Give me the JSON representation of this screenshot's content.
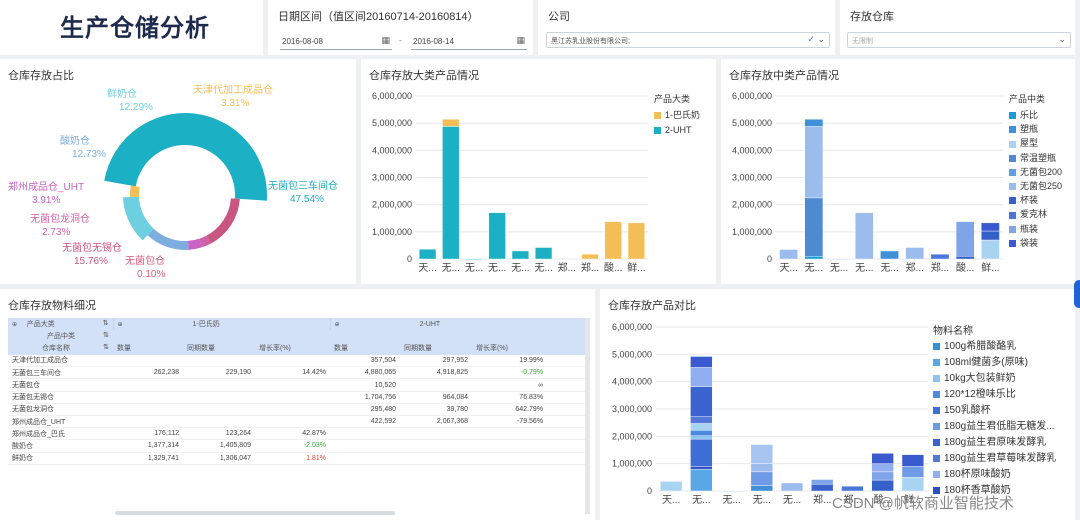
{
  "header": {
    "title": "生产仓储分析"
  },
  "filters": {
    "date_label": "日期区间（值区间20160714-20160814）",
    "date_start": "2016-08-08",
    "date_end": "2016-08-14",
    "date_sep": "-",
    "company_label": "公司",
    "company_value": "黑江苏乳业股份有限公司;",
    "warehouse_label": "存放仓库",
    "warehouse_placeholder": "无限制"
  },
  "donut": {
    "title": "仓库存放占比",
    "slices": [
      {
        "name": "无菌包三车间仓",
        "pct": "47.54%",
        "value": 47.54,
        "color": "#1bb0c4"
      },
      {
        "name": "无菌包仓",
        "pct": "0.10%",
        "value": 0.1,
        "color": "#e05b7d"
      },
      {
        "name": "无菌包无锡仓",
        "pct": "15.76%",
        "value": 15.76,
        "color": "#c9567f"
      },
      {
        "name": "无菌包龙洞仓",
        "pct": "2.73%",
        "value": 2.73,
        "color": "#d061a6"
      },
      {
        "name": "郑州成品仓_UHT",
        "pct": "3.91%",
        "value": 3.91,
        "color": "#c963c6"
      },
      {
        "name": "酸奶仓",
        "pct": "12.73%",
        "value": 12.73,
        "color": "#7eaee0"
      },
      {
        "name": "鲜奶仓",
        "pct": "12.29%",
        "value": 12.29,
        "color": "#6dcfe0"
      },
      {
        "name": "天津代加工成品仓",
        "pct": "3.31%",
        "value": 3.31,
        "color": "#f4be56"
      }
    ]
  },
  "big_chart": {
    "title": "仓库存放大类产品情况",
    "legend_title": "产品大类",
    "series": [
      {
        "name": "1-巴氏奶",
        "color": "#f4be56"
      },
      {
        "name": "2-UHT",
        "color": "#1bb0c4"
      }
    ]
  },
  "mid_chart": {
    "title": "仓库存放中类产品情况",
    "legend_title": "产品中类",
    "legend": [
      {
        "name": "乐比",
        "color": "#1a9bd7"
      },
      {
        "name": "塑瓶",
        "color": "#3f8fd9"
      },
      {
        "name": "屋型",
        "color": "#a8d4f2"
      },
      {
        "name": "常温塑瓶",
        "color": "#4e89d2"
      },
      {
        "name": "无菌包200",
        "color": "#5f9fe4"
      },
      {
        "name": "无菌包250",
        "color": "#9dbcee"
      },
      {
        "name": "杯装",
        "color": "#3460c9"
      },
      {
        "name": "爱克林",
        "color": "#4a76d8"
      },
      {
        "name": "瓶装",
        "color": "#7fa4e8"
      },
      {
        "name": "袋装",
        "color": "#3b5ad0"
      }
    ]
  },
  "cmp_chart": {
    "title": "仓库存放产品对比",
    "legend_title": "物料名称",
    "legend": [
      {
        "name": "100g希腊酸酪乳",
        "color": "#2f93d6"
      },
      {
        "name": "108ml健菌多(原味)",
        "color": "#5aa7e6"
      },
      {
        "name": "10kg大包装鲜奶",
        "color": "#8dc3f0"
      },
      {
        "name": "120*12橙味乐比",
        "color": "#4c8ae0"
      },
      {
        "name": "150乳酸杯",
        "color": "#3d6fd4"
      },
      {
        "name": "180g益生君低脂无糖发...",
        "color": "#6e9ae6"
      },
      {
        "name": "180g益生君原味发酵乳",
        "color": "#3b63cf"
      },
      {
        "name": "180g益生君草莓味发酵乳",
        "color": "#5378d9"
      },
      {
        "name": "180杯原味酸奶",
        "color": "#91aef0"
      },
      {
        "name": "180杯香草酸奶",
        "color": "#2a4fc4"
      }
    ]
  },
  "chart_data": [
    {
      "type": "pie",
      "title": "仓库存放占比",
      "categories": [
        "无菌包三车间仓",
        "无菌包仓",
        "无菌包无锡仓",
        "无菌包龙洞仓",
        "郑州成品仓_UHT",
        "酸奶仓",
        "鲜奶仓",
        "天津代加工成品仓"
      ],
      "values": [
        47.54,
        0.1,
        15.76,
        2.73,
        3.91,
        12.73,
        12.29,
        3.31
      ]
    },
    {
      "type": "bar",
      "title": "仓库存放大类产品情况",
      "categories": [
        "天...",
        "无...",
        "无...",
        "无...",
        "无...",
        "无...",
        "郑...",
        "郑...",
        "酸...",
        "鲜..."
      ],
      "yticks": [
        "0",
        "1,000,000",
        "2,000,000",
        "3,000,000",
        "4,000,000",
        "5,000,000",
        "6,000,000"
      ],
      "ylim": [
        0,
        6000000
      ],
      "series": [
        {
          "name": "1-巴氏奶",
          "values": [
            0,
            262238,
            0,
            0,
            0,
            0,
            0,
            176112,
            1377314,
            1329741
          ]
        },
        {
          "name": "2-UHT",
          "values": [
            357504,
            4880065,
            10520,
            1704756,
            295480,
            422592,
            0,
            0,
            0,
            0
          ]
        }
      ]
    },
    {
      "type": "bar",
      "title": "仓库存放中类产品情况",
      "categories": [
        "天...",
        "无...",
        "无...",
        "无...",
        "无...",
        "郑...",
        "郑...",
        "酸...",
        "鲜..."
      ],
      "yticks": [
        "0",
        "1,000,000",
        "2,000,000",
        "3,000,000",
        "4,000,000",
        "5,000,000",
        "6,000,000"
      ],
      "ylim": [
        0,
        6000000
      ],
      "stacks": [
        [
          {
            "c": "#9dbcee",
            "v": 350000
          }
        ],
        [
          {
            "c": "#1a9bd7",
            "v": 100000
          },
          {
            "c": "#4e89d2",
            "v": 2150000
          },
          {
            "c": "#9dbcee",
            "v": 2630000
          },
          {
            "c": "#3f8fd9",
            "v": 262000
          }
        ],
        [
          {
            "c": "#9dbcee",
            "v": 10500
          }
        ],
        [
          {
            "c": "#9dbcee",
            "v": 1705000
          }
        ],
        [
          {
            "c": "#3f8fd9",
            "v": 295000
          }
        ],
        [
          {
            "c": "#9dbcee",
            "v": 423000
          }
        ],
        [
          {
            "c": "#4a76d8",
            "v": 176000
          }
        ],
        [
          {
            "c": "#3460c9",
            "v": 100000
          },
          {
            "c": "#7fa4e8",
            "v": 1277000
          }
        ],
        [
          {
            "c": "#a8d4f2",
            "v": 700000
          },
          {
            "c": "#3460c9",
            "v": 330000
          },
          {
            "c": "#3b5ad0",
            "v": 300000
          }
        ]
      ]
    },
    {
      "type": "bar",
      "title": "仓库存放产品对比",
      "categories": [
        "天...",
        "无...",
        "无...",
        "无...",
        "无...",
        "郑...",
        "郑...",
        "酸...",
        "鲜..."
      ],
      "yticks": [
        "0",
        "1,000,000",
        "2,000,000",
        "3,000,000",
        "4,000,000",
        "5,000,000",
        "6,000,000"
      ],
      "ylim": [
        0,
        6000000
      ],
      "stacks": [
        [
          {
            "c": "#a8d4f2",
            "v": 350000
          }
        ],
        [
          {
            "c": "#5aa7e6",
            "v": 800000
          },
          {
            "c": "#2a4fc4",
            "v": 100000
          },
          {
            "c": "#3d6fd4",
            "v": 1000000
          },
          {
            "c": "#8dc3f0",
            "v": 120000
          },
          {
            "c": "#4c8ae0",
            "v": 200000
          },
          {
            "c": "#a8d4f2",
            "v": 250000
          },
          {
            "c": "#5378d9",
            "v": 250000
          },
          {
            "c": "#3b63cf",
            "v": 1100000
          },
          {
            "c": "#91aef0",
            "v": 700000
          },
          {
            "c": "#3b5ad0",
            "v": 400000
          },
          {
            "c": "#2f93d6",
            "v": 20000
          }
        ],
        [
          {
            "c": "#9dbcee",
            "v": 10500
          }
        ],
        [
          {
            "c": "#3f8fd9",
            "v": 200000
          },
          {
            "c": "#6e9ae6",
            "v": 500000
          },
          {
            "c": "#9dbcee",
            "v": 300000
          },
          {
            "c": "#a8c4f2",
            "v": 700000
          }
        ],
        [
          {
            "c": "#9dbcee",
            "v": 295000
          }
        ],
        [
          {
            "c": "#3b63cf",
            "v": 250000
          },
          {
            "c": "#7fa4e8",
            "v": 170000
          }
        ],
        [
          {
            "c": "#4a76d8",
            "v": 176000
          }
        ],
        [
          {
            "c": "#3460c9",
            "v": 400000
          },
          {
            "c": "#7fa4e8",
            "v": 300000
          },
          {
            "c": "#91aef0",
            "v": 300000
          },
          {
            "c": "#3b5ad0",
            "v": 377000
          }
        ],
        [
          {
            "c": "#a8d4f2",
            "v": 500000
          },
          {
            "c": "#6e9ae6",
            "v": 400000
          },
          {
            "c": "#3b5ad0",
            "v": 430000
          }
        ]
      ]
    }
  ],
  "table": {
    "title": "仓库存放物料细况",
    "dim1": "产品大类",
    "dim2": "产品中类",
    "dim3": "仓库名称",
    "group1": "1-巴氏奶",
    "group2": "2-UHT",
    "col_qty": "数量",
    "col_prev": "同期数量",
    "col_growth": "增长率(%)",
    "rows": [
      {
        "name": "天津代加工成品仓",
        "q1": "",
        "p1": "",
        "g1": "",
        "q2": "357,504",
        "p2": "297,952",
        "g2": "19.99%",
        "c1": "",
        "c2": ""
      },
      {
        "name": "无菌包三车间仓",
        "q1": "262,238",
        "p1": "229,190",
        "g1": "14.42%",
        "q2": "4,880,065",
        "p2": "4,918,825",
        "g2": "-0.79%",
        "c1": "",
        "c2": "#3aa63a"
      },
      {
        "name": "无菌包仓",
        "q1": "",
        "p1": "",
        "g1": "",
        "q2": "10,520",
        "p2": "",
        "g2": "∞",
        "c1": "",
        "c2": ""
      },
      {
        "name": "无菌包无锡仓",
        "q1": "",
        "p1": "",
        "g1": "",
        "q2": "1,704,756",
        "p2": "964,084",
        "g2": "76.83%",
        "c1": "",
        "c2": ""
      },
      {
        "name": "无菌包龙洞仓",
        "q1": "",
        "p1": "",
        "g1": "",
        "q2": "295,480",
        "p2": "39,780",
        "g2": "642.79%",
        "c1": "",
        "c2": ""
      },
      {
        "name": "郑州成品仓_UHT",
        "q1": "",
        "p1": "",
        "g1": "",
        "q2": "422,592",
        "p2": "2,067,368",
        "g2": "-79.56%",
        "c1": "",
        "c2": ""
      },
      {
        "name": "郑州成品仓_巴氏",
        "q1": "176,112",
        "p1": "123,264",
        "g1": "42.87%",
        "q2": "",
        "p2": "",
        "g2": "",
        "c1": "",
        "c2": ""
      },
      {
        "name": "酸奶仓",
        "q1": "1,377,314",
        "p1": "1,405,809",
        "g1": "-2.03%",
        "q2": "",
        "p2": "",
        "g2": "",
        "c1": "#3aa63a",
        "c2": ""
      },
      {
        "name": "鲜奶仓",
        "q1": "1,329,741",
        "p1": "1,306,047",
        "g1": "1.81%",
        "q2": "",
        "p2": "",
        "g2": "",
        "c1": "#e0453a",
        "c2": ""
      }
    ]
  },
  "watermark": "CSDN @帆软商业智能技术",
  "colors": {
    "up": "#e0453a",
    "down": "#3aa63a",
    "accent": "#1bb0c4"
  }
}
